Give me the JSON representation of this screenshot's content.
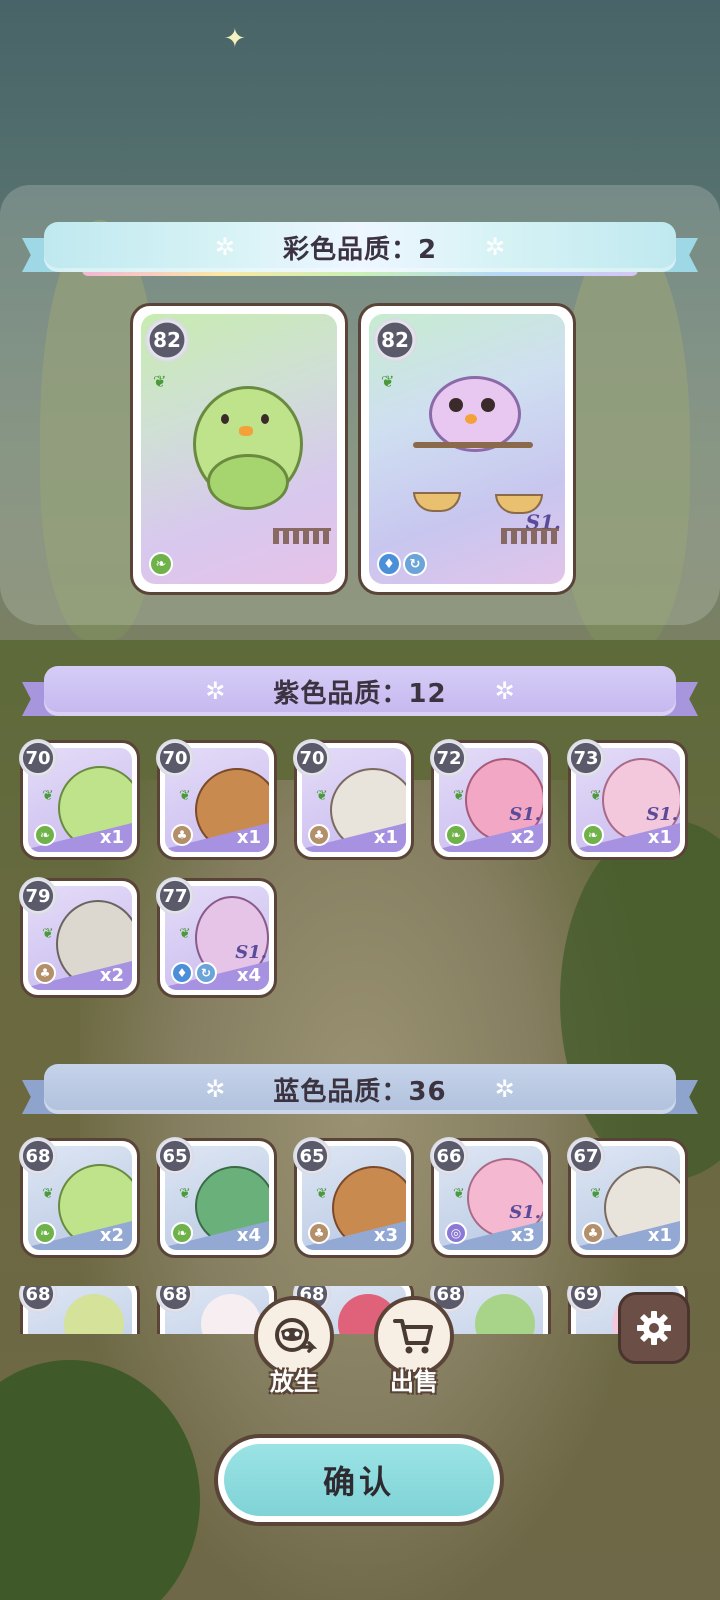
{
  "sections": {
    "rainbow": {
      "title": "彩色品质：2"
    },
    "purple": {
      "title": "紫色品质：12"
    },
    "blue": {
      "title": "蓝色品质：36"
    }
  },
  "rainbow_cards": [
    {
      "level": "82",
      "creature": "cabbage-chick",
      "elements": [
        "grass"
      ]
    },
    {
      "level": "82",
      "creature": "scale-owl",
      "elements": [
        "water",
        "wind"
      ],
      "badge": "S1."
    }
  ],
  "purple_cards": [
    {
      "level": "70",
      "creature": "cabbage-chick",
      "qty": "x1",
      "elements": [
        "grass"
      ]
    },
    {
      "level": "70",
      "creature": "beaver",
      "qty": "x1",
      "elements": [
        "earth"
      ]
    },
    {
      "level": "70",
      "creature": "armored-bunny",
      "qty": "x1",
      "elements": [
        "earth"
      ]
    },
    {
      "level": "72",
      "creature": "pink-fairy",
      "qty": "x2",
      "elements": [
        "grass"
      ],
      "badge": "S1."
    },
    {
      "level": "73",
      "creature": "lotus-spirit",
      "qty": "x1",
      "elements": [
        "grass"
      ],
      "badge": "S1."
    },
    {
      "level": "79",
      "creature": "stone-knight",
      "qty": "x2",
      "elements": [
        "earth"
      ]
    },
    {
      "level": "77",
      "creature": "owl-chick",
      "qty": "x4",
      "elements": [
        "water",
        "wind"
      ],
      "badge": "S1."
    }
  ],
  "blue_cards": [
    {
      "level": "68",
      "creature": "cabbage-chick",
      "qty": "x2",
      "elements": [
        "grass"
      ]
    },
    {
      "level": "65",
      "creature": "propeller-frog",
      "qty": "x4",
      "elements": [
        "grass"
      ]
    },
    {
      "level": "65",
      "creature": "beaver",
      "qty": "x3",
      "elements": [
        "earth"
      ]
    },
    {
      "level": "66",
      "creature": "glasses-axolotl",
      "qty": "x3",
      "elements": [
        "psychic"
      ],
      "badge": "S1."
    },
    {
      "level": "67",
      "creature": "armored-bunny",
      "qty": "x1",
      "elements": [
        "earth"
      ]
    }
  ],
  "blue_cards_partial_levels": [
    "68",
    "68",
    "68",
    "68",
    "69"
  ],
  "actions": {
    "release": {
      "label": "放生",
      "icon": "raccoon-release-icon"
    },
    "sell": {
      "label": "出售",
      "icon": "shopping-cart-icon"
    },
    "settings": {
      "icon": "gear-icon"
    },
    "confirm": {
      "label": "确认"
    }
  },
  "colors": {
    "card_border": "#5a4438",
    "purple_ribbon": "#c4b7ef",
    "blue_ribbon": "#b1c1dc",
    "rainbow_ribbon": "#bfe9ef",
    "confirm_button": "#7fd3d6"
  }
}
